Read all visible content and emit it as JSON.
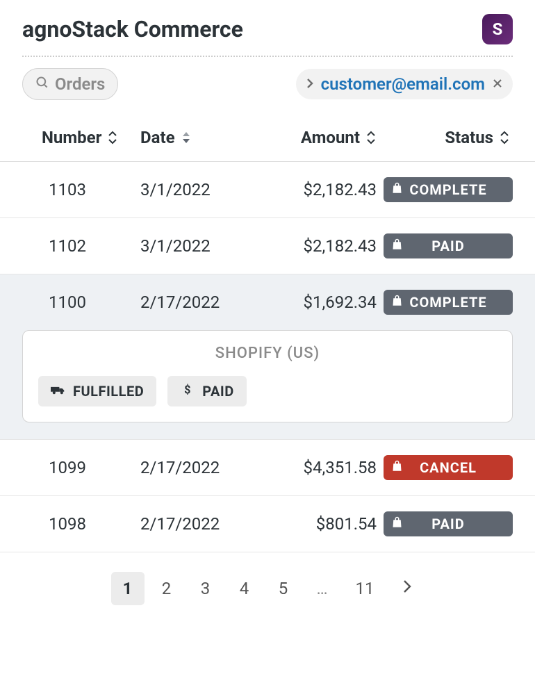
{
  "header": {
    "title": "agnoStack Commerce",
    "logoLetter": "S"
  },
  "filters": {
    "ordersLabel": "Orders",
    "customerEmail": "customer@email.com"
  },
  "columns": {
    "number": "Number",
    "date": "Date",
    "amount": "Amount",
    "status": "Status"
  },
  "rows": [
    {
      "number": "1103",
      "date": "3/1/2022",
      "amount": "$2,182.43",
      "status": "COMPLETE",
      "statusStyle": "complete",
      "expanded": false
    },
    {
      "number": "1102",
      "date": "3/1/2022",
      "amount": "$2,182.43",
      "status": "PAID",
      "statusStyle": "paid",
      "expanded": false
    },
    {
      "number": "1100",
      "date": "2/17/2022",
      "amount": "$1,692.34",
      "status": "COMPLETE",
      "statusStyle": "complete",
      "expanded": true,
      "detail": {
        "provider": "SHOPIFY (US)",
        "chips": [
          {
            "icon": "truck",
            "label": "FULFILLED"
          },
          {
            "icon": "dollar",
            "label": "PAID"
          }
        ]
      }
    },
    {
      "number": "1099",
      "date": "2/17/2022",
      "amount": "$4,351.58",
      "status": "CANCEL",
      "statusStyle": "cancel",
      "expanded": false
    },
    {
      "number": "1098",
      "date": "2/17/2022",
      "amount": "$801.54",
      "status": "PAID",
      "statusStyle": "paid",
      "expanded": false
    }
  ],
  "pagination": {
    "pages": [
      "1",
      "2",
      "3",
      "4",
      "5"
    ],
    "ellipsis": "…",
    "last": "11",
    "active": "1"
  }
}
